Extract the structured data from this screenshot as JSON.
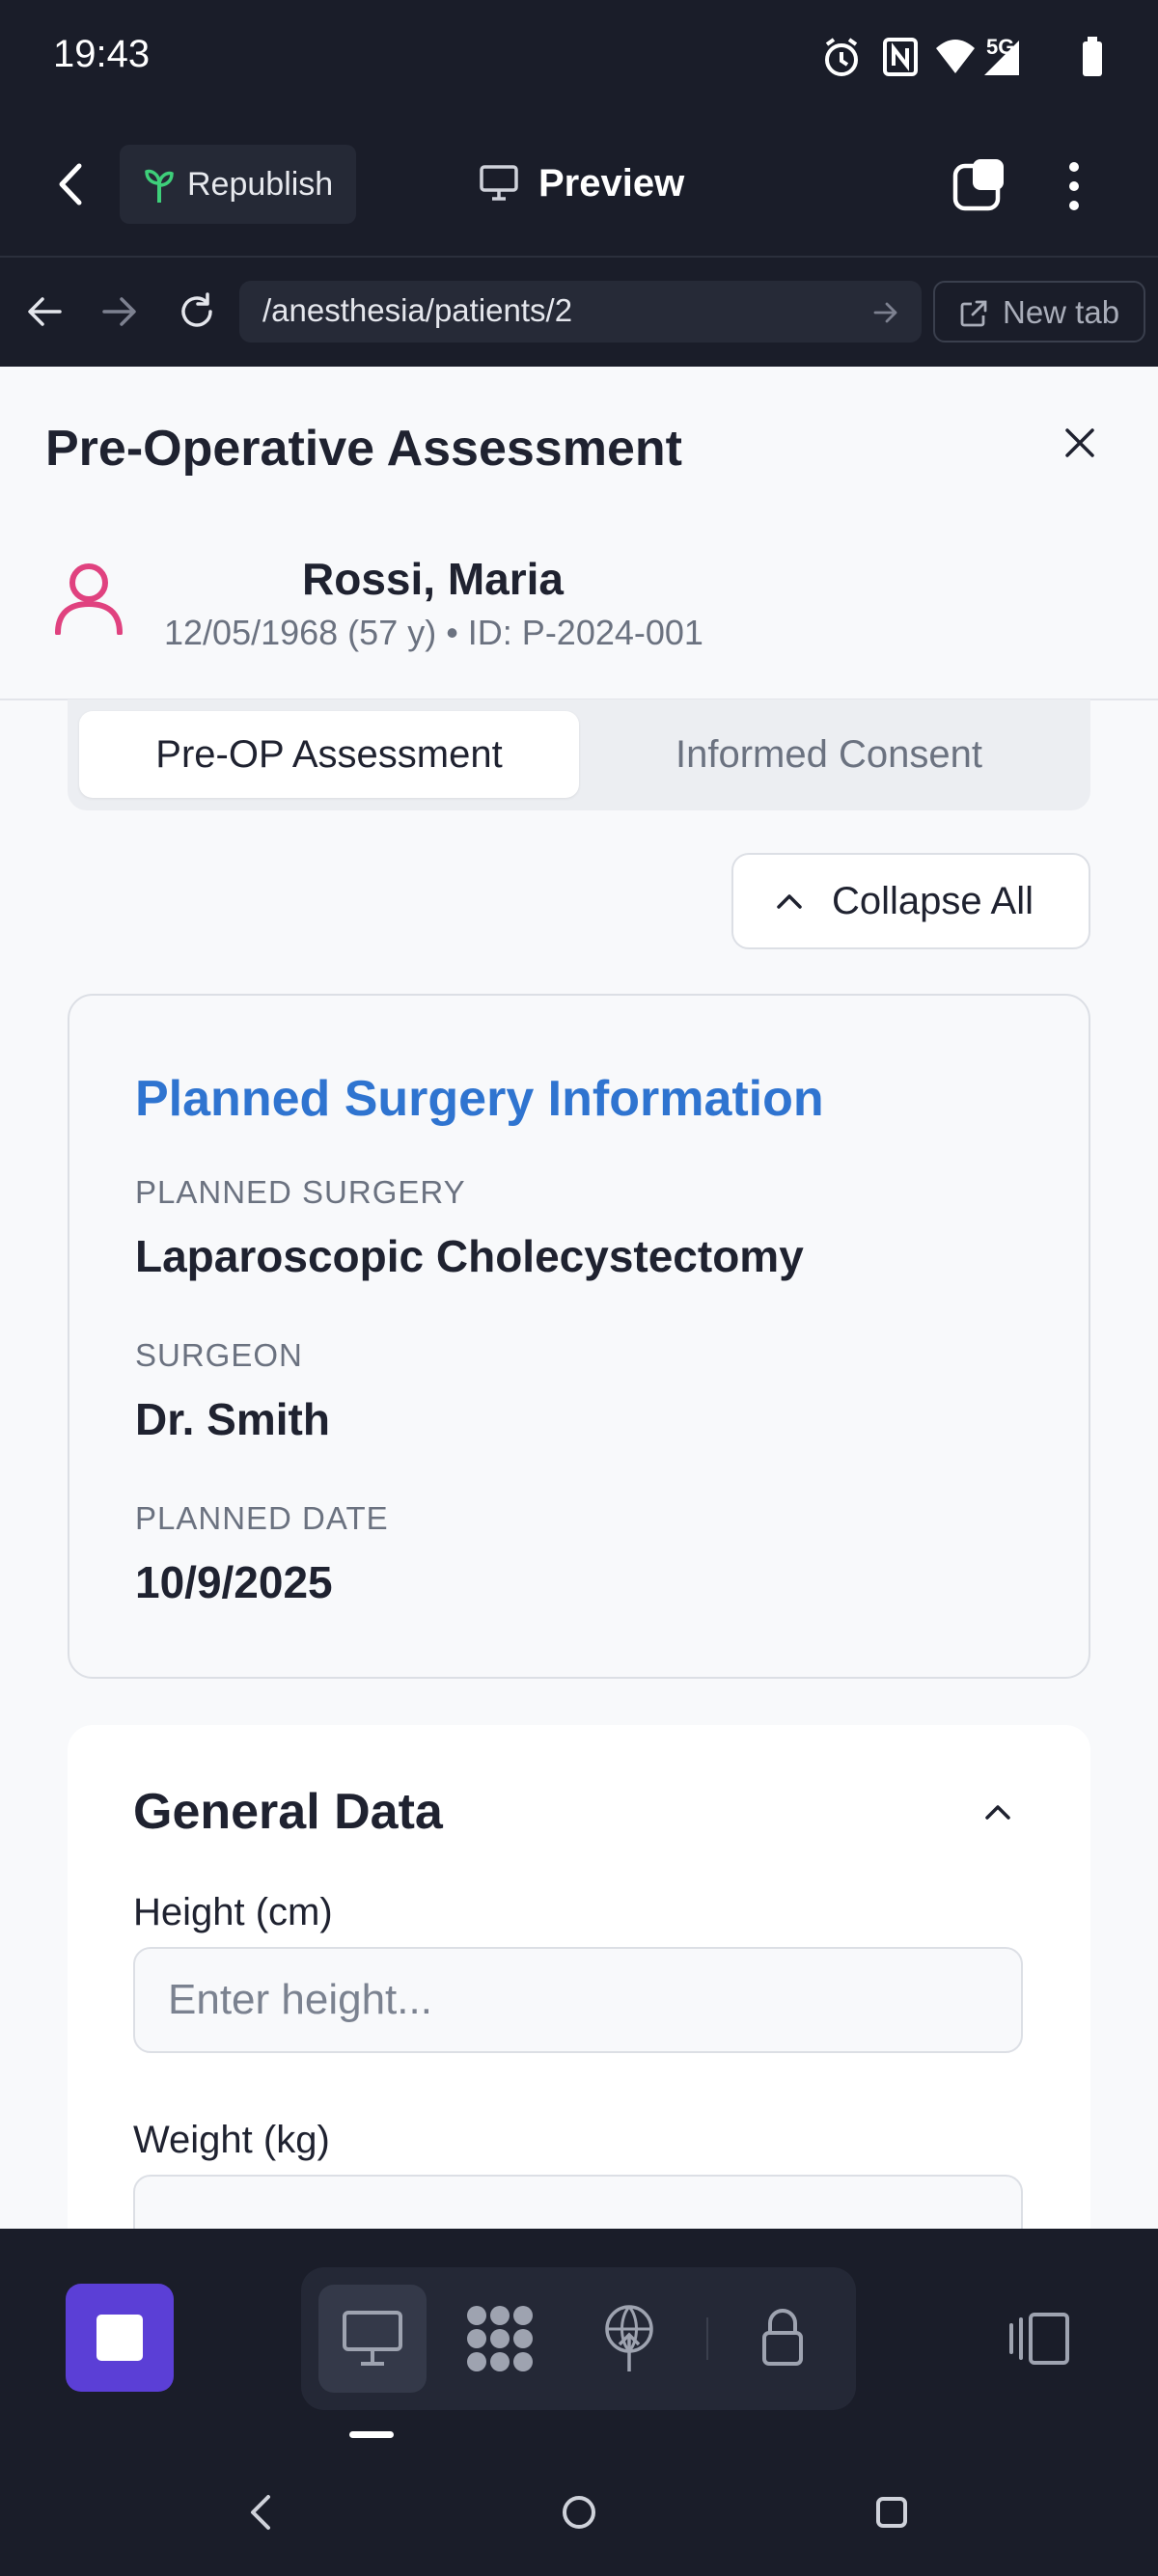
{
  "status_bar": {
    "time": "19:43",
    "network": "5G"
  },
  "app_bar": {
    "republish_label": "Republish",
    "preview_label": "Preview"
  },
  "browser": {
    "url": "/anesthesia/patients/2",
    "new_tab_label": "New tab"
  },
  "page": {
    "title": "Pre-Operative Assessment",
    "patient": {
      "name": "Rossi, Maria",
      "meta": "12/05/1968 (57 y) • ID: P-2024-001"
    },
    "tabs": [
      {
        "label": "Pre-OP Assessment",
        "active": true
      },
      {
        "label": "Informed Consent",
        "active": false
      }
    ],
    "collapse_all_label": "Collapse All",
    "surgery_card": {
      "title": "Planned Surgery Information",
      "fields": [
        {
          "label": "PLANNED SURGERY",
          "value": "Laparoscopic Cholecystectomy"
        },
        {
          "label": "SURGEON",
          "value": "Dr. Smith"
        },
        {
          "label": "PLANNED DATE",
          "value": "10/9/2025"
        }
      ]
    },
    "general_card": {
      "title": "General Data",
      "height_label": "Height (cm)",
      "height_placeholder": "Enter height...",
      "weight_label": "Weight (kg)",
      "weight_placeholder": ""
    }
  },
  "colors": {
    "accent_blue": "#2f74d0",
    "brand_purple": "#5b3fd6",
    "patient_icon_pink": "#e0427f",
    "dark_bg": "#1a1d29"
  },
  "icons": [
    "alarm-icon",
    "nfc-icon",
    "wifi-icon",
    "signal-icon",
    "battery-icon",
    "back-icon",
    "sprout-icon",
    "monitor-icon",
    "tabs-icon",
    "more-icon",
    "arrow-left-icon",
    "arrow-right-icon",
    "reload-icon",
    "go-icon",
    "external-link-icon",
    "close-icon",
    "user-icon",
    "chevron-up-icon",
    "stop-icon",
    "desktop-icon",
    "grid-icon",
    "publish-icon",
    "lock-icon",
    "sidebar-icon",
    "nav-back-icon",
    "nav-home-icon",
    "nav-recents-icon"
  ]
}
